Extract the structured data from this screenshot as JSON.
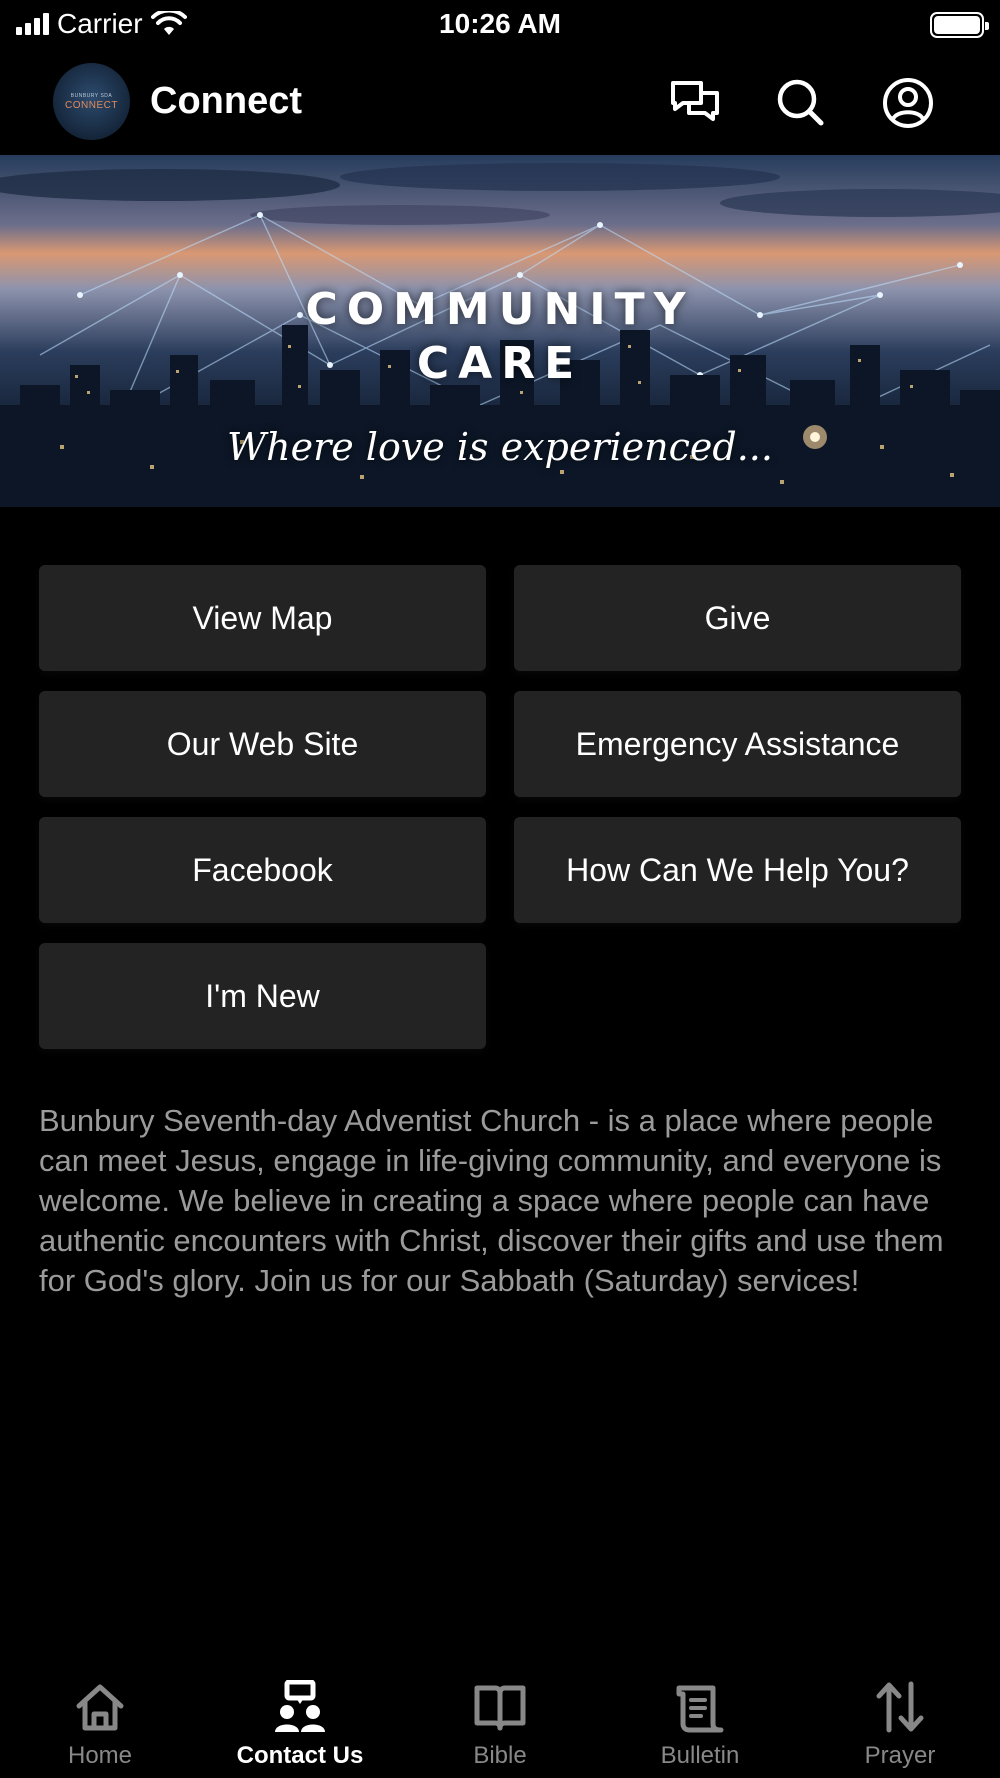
{
  "status_bar": {
    "carrier": "Carrier",
    "time": "10:26 AM"
  },
  "header": {
    "logo_text_small": "BUNBURY SDA",
    "logo_text_main": "CONNECT",
    "title": "Connect",
    "icons": [
      "chat-icon",
      "search-icon",
      "profile-icon"
    ]
  },
  "banner": {
    "title": "COMMUNITY\nCARE",
    "tagline": "Where love is experienced..."
  },
  "buttons": [
    {
      "label": "View Map"
    },
    {
      "label": "Give"
    },
    {
      "label": "Our Web Site"
    },
    {
      "label": "Emergency Assistance"
    },
    {
      "label": "Facebook"
    },
    {
      "label": "How Can We Help You?"
    },
    {
      "label": "I'm New"
    }
  ],
  "description": "Bunbury Seventh-day Adventist Church - is a place where people can meet Jesus, engage in life-giving community, and everyone is welcome. We believe in creating a space where people can have authentic encounters with Christ, discover their gifts and use them for God's glory. Join us for our Sabbath (Saturday) services!",
  "tabbar": {
    "active": "Contact Us",
    "items": [
      {
        "label": "Home",
        "icon": "home-icon"
      },
      {
        "label": "Contact Us",
        "icon": "contact-icon"
      },
      {
        "label": "Bible",
        "icon": "book-icon"
      },
      {
        "label": "Bulletin",
        "icon": "scroll-icon"
      },
      {
        "label": "Prayer",
        "icon": "sort-arrows-icon"
      }
    ]
  },
  "colors": {
    "background": "#000000",
    "button_bg": "#232323",
    "description_text": "#9b9b9b",
    "tab_inactive": "#888888",
    "tab_active": "#ffffff"
  }
}
